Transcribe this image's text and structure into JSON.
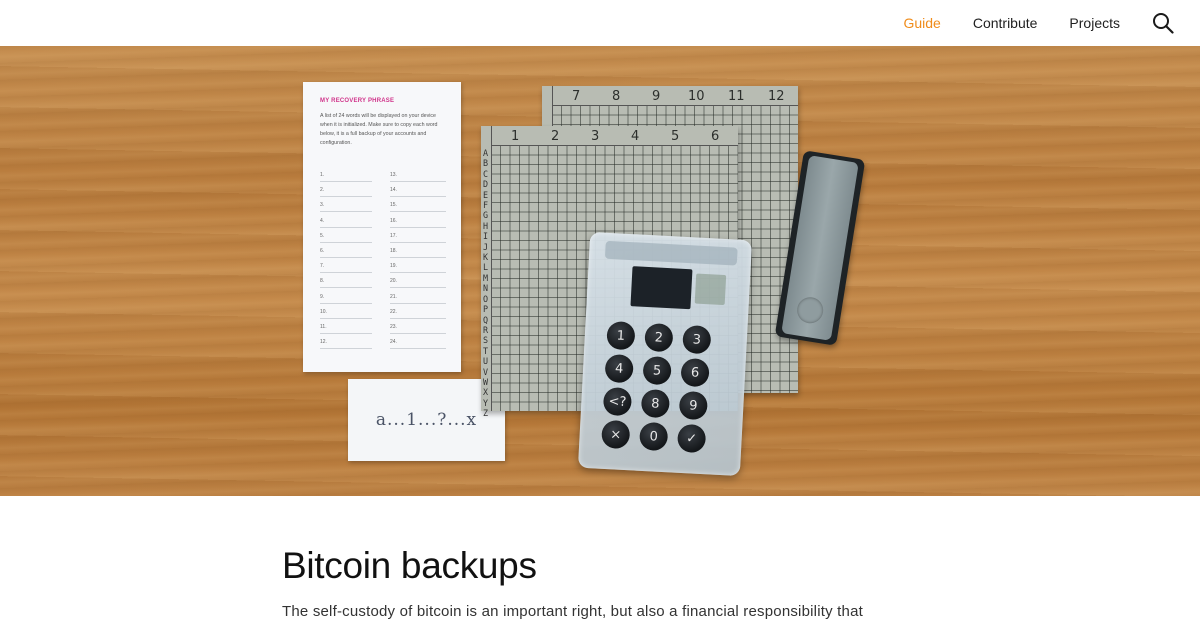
{
  "nav": {
    "items": [
      {
        "label": "Guide",
        "active": true
      },
      {
        "label": "Contribute",
        "active": false
      },
      {
        "label": "Projects",
        "active": false
      }
    ],
    "search_icon": "search-icon",
    "accent_color": "#f08c1a"
  },
  "hero": {
    "card": {
      "title": "MY RECOVERY PHRASE",
      "text": "A list of 24 words will be displayed on your device when it is initialized. Make sure to copy each word below, it is a full backup of your accounts and configuration.",
      "left_numbers": [
        "1.",
        "2.",
        "3.",
        "4.",
        "5.",
        "6.",
        "7.",
        "8.",
        "9.",
        "10.",
        "11.",
        "12."
      ],
      "right_numbers": [
        "13.",
        "14.",
        "15.",
        "16.",
        "17.",
        "18.",
        "19.",
        "20.",
        "21.",
        "22.",
        "23.",
        "24."
      ]
    },
    "note_text": "a...1...?...x",
    "grid_back_numbers": [
      "7",
      "8",
      "9",
      "10",
      "11",
      "12"
    ],
    "grid_front_numbers": [
      "1",
      "2",
      "3",
      "4",
      "5",
      "6"
    ],
    "grid_letters": "ABCDEFGHIJKLMNOPQRSTUVWXYZ",
    "keypad": [
      "1",
      "2",
      "3",
      "4",
      "5",
      "6",
      "<?",
      "8",
      "9",
      "×",
      "0",
      "✓"
    ]
  },
  "article": {
    "title": "Bitcoin backups",
    "intro": "The self-custody of bitcoin is an important right, but also a financial responsibility that"
  }
}
